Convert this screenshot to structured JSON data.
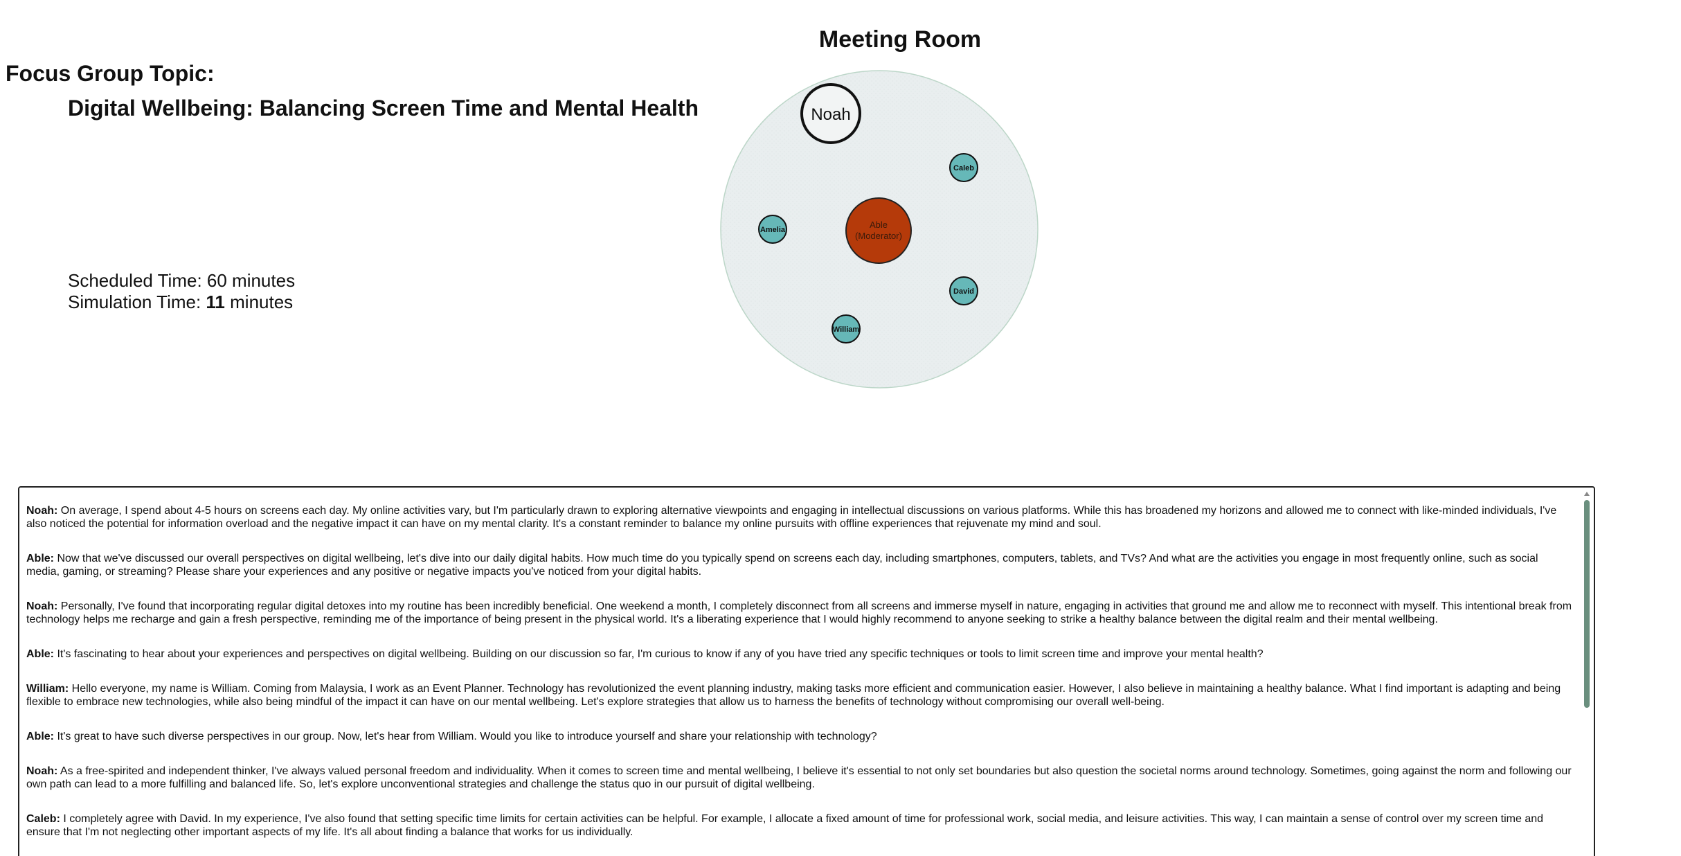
{
  "focus_group": {
    "heading": "Focus Group Topic:",
    "topic": "Digital Wellbeing: Balancing Screen Time and Mental Health",
    "scheduled_label": "Scheduled Time: ",
    "scheduled_value": "60 minutes",
    "simulation_label": "Simulation Time: ",
    "simulation_value": "11",
    "simulation_unit": " minutes"
  },
  "meeting_room": {
    "title": "Meeting Room",
    "moderator": {
      "name": "Able",
      "role": "(Moderator)",
      "color": "#b53a0a"
    },
    "participants": [
      {
        "name": "Noah",
        "speaking": true
      },
      {
        "name": "Caleb",
        "speaking": false
      },
      {
        "name": "Amelia",
        "speaking": false
      },
      {
        "name": "David",
        "speaking": false
      },
      {
        "name": "William",
        "speaking": false
      }
    ],
    "participant_color": "#66b8b8",
    "room_color": "#e9eeef"
  },
  "transcript": [
    {
      "speaker": "Noah:",
      "text": " On average, I spend about 4-5 hours on screens each day. My online activities vary, but I'm particularly drawn to exploring alternative viewpoints and engaging in intellectual discussions on various platforms. While this has broadened my horizons and allowed me to connect with like-minded individuals, I've also noticed the potential for information overload and the negative impact it can have on my mental clarity. It's a constant reminder to balance my online pursuits with offline experiences that rejuvenate my mind and soul."
    },
    {
      "speaker": "Able:",
      "text": " Now that we've discussed our overall perspectives on digital wellbeing, let's dive into our daily digital habits. How much time do you typically spend on screens each day, including smartphones, computers, tablets, and TVs? And what are the activities you engage in most frequently online, such as social media, gaming, or streaming? Please share your experiences and any positive or negative impacts you've noticed from your digital habits."
    },
    {
      "speaker": "Noah:",
      "text": " Personally, I've found that incorporating regular digital detoxes into my routine has been incredibly beneficial. One weekend a month, I completely disconnect from all screens and immerse myself in nature, engaging in activities that ground me and allow me to reconnect with myself. This intentional break from technology helps me recharge and gain a fresh perspective, reminding me of the importance of being present in the physical world. It's a liberating experience that I would highly recommend to anyone seeking to strike a healthy balance between the digital realm and their mental wellbeing."
    },
    {
      "speaker": "Able:",
      "text": " It's fascinating to hear about your experiences and perspectives on digital wellbeing. Building on our discussion so far, I'm curious to know if any of you have tried any specific techniques or tools to limit screen time and improve your mental health?"
    },
    {
      "speaker": "William:",
      "text": " Hello everyone, my name is William. Coming from Malaysia, I work as an Event Planner. Technology has revolutionized the event planning industry, making tasks more efficient and communication easier. However, I also believe in maintaining a healthy balance. What I find important is adapting and being flexible to embrace new technologies, while also being mindful of the impact it can have on our mental wellbeing. Let's explore strategies that allow us to harness the benefits of technology without compromising our overall well-being."
    },
    {
      "speaker": "Able:",
      "text": " It's great to have such diverse perspectives in our group. Now, let's hear from William. Would you like to introduce yourself and share your relationship with technology?"
    },
    {
      "speaker": "Noah:",
      "text": " As a free-spirited and independent thinker, I've always valued personal freedom and individuality. When it comes to screen time and mental wellbeing, I believe it's essential to not only set boundaries but also question the societal norms around technology. Sometimes, going against the norm and following our own path can lead to a more fulfilling and balanced life. So, let's explore unconventional strategies and challenge the status quo in our pursuit of digital wellbeing."
    },
    {
      "speaker": "Caleb:",
      "text": " I completely agree with David. In my experience, I've also found that setting specific time limits for certain activities can be helpful. For example, I allocate a fixed amount of time for professional work, social media, and leisure activities. This way, I can maintain a sense of control over my screen time and ensure that I'm not neglecting other important aspects of my life. It's all about finding a balance that works for us individually."
    }
  ]
}
